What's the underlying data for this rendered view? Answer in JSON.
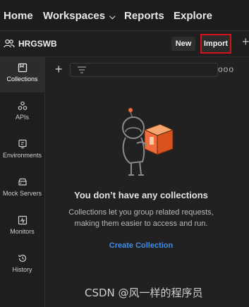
{
  "topbar": {
    "home": "Home",
    "workspaces": "Workspaces",
    "reports": "Reports",
    "explore": "Explore"
  },
  "workspace": {
    "name": "HRGSWB",
    "new_label": "New",
    "import_label": "Import",
    "plus": "+"
  },
  "sidebar": {
    "items": [
      {
        "label": "Collections",
        "icon": "collections-icon",
        "active": true
      },
      {
        "label": "APIs",
        "icon": "apis-icon"
      },
      {
        "label": "Environments",
        "icon": "environments-icon"
      },
      {
        "label": "Mock Servers",
        "icon": "mock-servers-icon"
      },
      {
        "label": "Monitors",
        "icon": "monitors-icon"
      },
      {
        "label": "History",
        "icon": "history-icon"
      }
    ]
  },
  "main": {
    "add": "+",
    "more": "ooo",
    "empty_title": "You don’t have any collections",
    "empty_desc": "Collections let you group related requests, making them easier to access and run.",
    "create_link": "Create Collection"
  },
  "colors": {
    "accent_link": "#3f8dea",
    "import_highlight": "#d4141a",
    "illustration_orange": "#f26b3a"
  },
  "watermark": "CSDN @风一样的程序员"
}
